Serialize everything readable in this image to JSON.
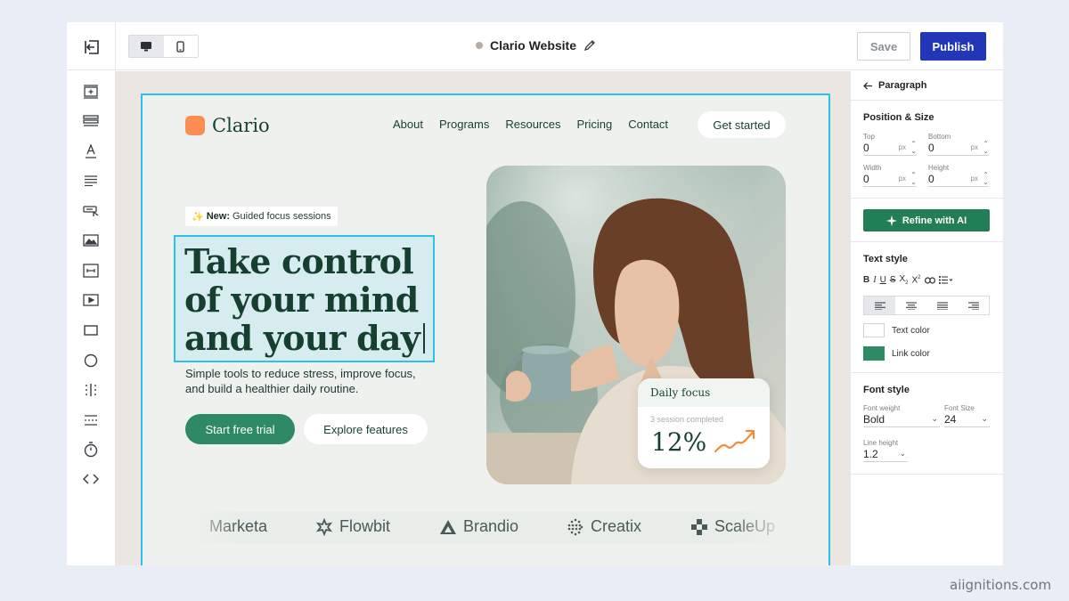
{
  "topbar": {
    "site_title": "Clario Website",
    "save_label": "Save",
    "publish_label": "Publish",
    "publish_color": "#2137b8"
  },
  "tools": [
    "add-section-icon",
    "rows-icon",
    "text-icon",
    "paragraph-icon",
    "button-icon",
    "image-icon",
    "embed-icon",
    "video-icon",
    "rectangle-icon",
    "circle-icon",
    "columns-icon",
    "divider-icon",
    "timer-icon",
    "code-icon"
  ],
  "site": {
    "brand": "Clario",
    "nav": [
      "About",
      "Programs",
      "Resources",
      "Pricing",
      "Contact"
    ],
    "nav_cta": "Get started",
    "badge_emoji": "✨",
    "badge_bold": "New:",
    "badge_text": "Guided focus sessions",
    "headline": "Take control of your mind and your day",
    "subtext": "Simple tools to reduce stress, improve focus, and build a healthier daily routine.",
    "cta_primary": "Start free trial",
    "cta_secondary": "Explore features",
    "focus_card": {
      "title": "Daily focus",
      "subtitle": "3 session completed",
      "value": "12%"
    },
    "logos": [
      "Marketa",
      "Flowbit",
      "Brandio",
      "Creatix",
      "ScaleUp"
    ],
    "accent_green": "#2e8a64",
    "brand_orange": "#fb8c52"
  },
  "props": {
    "back_label": "Paragraph",
    "position_size": {
      "title": "Position & Size",
      "top_label": "Top",
      "top_value": "0",
      "bottom_label": "Bottom",
      "bottom_value": "0",
      "width_label": "Width",
      "width_value": "0",
      "height_label": "Height",
      "height_value": "0",
      "unit": "px"
    },
    "refine_label": "Refine with AI",
    "text_style": {
      "title": "Text style",
      "text_color_label": "Text color",
      "link_color_label": "Link color",
      "text_color": "#ffffff",
      "link_color": "#2e8a64"
    },
    "font_style": {
      "title": "Font style",
      "weight_label": "Font weight",
      "weight_value": "Bold",
      "size_label": "Font Size",
      "size_value": "24",
      "line_height_label": "Line height",
      "line_height_value": "1.2"
    }
  },
  "watermark": "aiignitions.com"
}
